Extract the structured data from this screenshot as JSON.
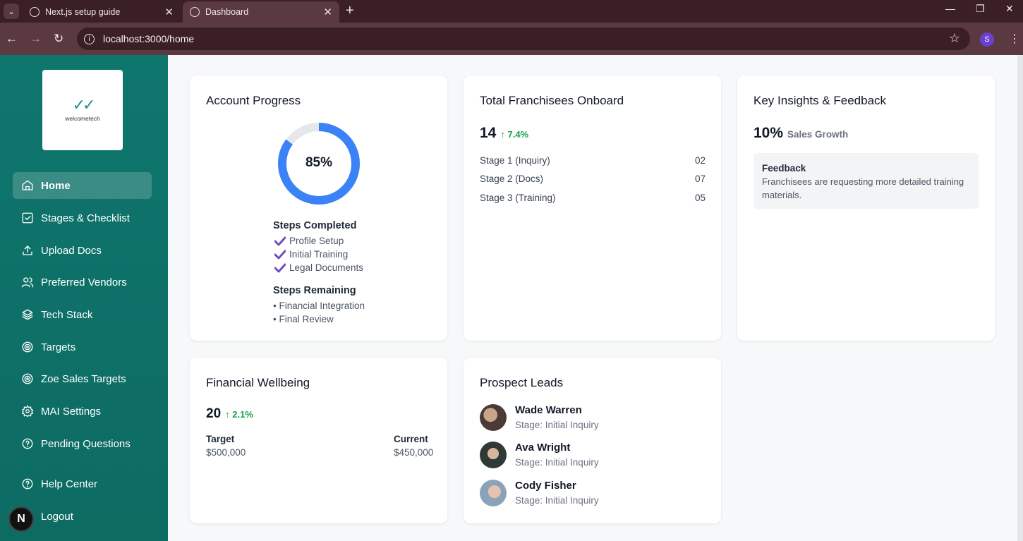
{
  "browser": {
    "tabs": [
      {
        "title": "Next.js setup guide"
      },
      {
        "title": "Dashboard"
      }
    ],
    "url": "localhost:3000/home",
    "profile_initial": "S"
  },
  "sidebar": {
    "logo_text": "welcometech",
    "items": [
      {
        "label": "Home",
        "icon": "home-icon"
      },
      {
        "label": "Stages & Checklist",
        "icon": "checklist-icon"
      },
      {
        "label": "Upload Docs",
        "icon": "upload-icon"
      },
      {
        "label": "Preferred Vendors",
        "icon": "users-icon"
      },
      {
        "label": "Tech Stack",
        "icon": "layers-icon"
      },
      {
        "label": "Targets",
        "icon": "target-icon"
      },
      {
        "label": "Zoe Sales Targets",
        "icon": "target-icon"
      },
      {
        "label": "MAI Settings",
        "icon": "gear-icon"
      },
      {
        "label": "Pending Questions",
        "icon": "help-circle-icon"
      },
      {
        "label": "Help Center",
        "icon": "help-circle-icon"
      },
      {
        "label": "Logout",
        "icon": "logout-icon"
      }
    ],
    "badge": "N"
  },
  "account_progress": {
    "title": "Account Progress",
    "percent_label": "85%",
    "percent": 85,
    "completed_title": "Steps Completed",
    "completed": [
      "Profile Setup",
      "Initial Training",
      "Legal Documents"
    ],
    "remaining_title": "Steps Remaining",
    "remaining": [
      "• Financial Integration",
      "• Final Review"
    ]
  },
  "franchisees": {
    "title": "Total Franchisees Onboard",
    "total": "14",
    "delta": "↑ 7.4%",
    "stages": [
      {
        "label": "Stage 1 (Inquiry)",
        "value": "02"
      },
      {
        "label": "Stage 2 (Docs)",
        "value": "07"
      },
      {
        "label": "Stage 3 (Training)",
        "value": "05"
      }
    ]
  },
  "insights": {
    "title": "Key Insights & Feedback",
    "value": "10%",
    "value_label": "Sales Growth",
    "feedback_title": "Feedback",
    "feedback_text": "Franchisees are requesting more detailed training materials."
  },
  "financial": {
    "title": "Financial Wellbeing",
    "value": "20",
    "delta": "↑ 2.1%",
    "target_label": "Target",
    "target_value": "$500,000",
    "current_label": "Current",
    "current_value": "$450,000"
  },
  "leads": {
    "title": "Prospect Leads",
    "items": [
      {
        "name": "Wade Warren",
        "stage": "Stage: Initial Inquiry"
      },
      {
        "name": "Ava Wright",
        "stage": "Stage: Initial Inquiry"
      },
      {
        "name": "Cody Fisher",
        "stage": "Stage: Initial Inquiry"
      }
    ]
  },
  "colors": {
    "sidebar": "#0f766e",
    "accent_ring": "#3b82f6",
    "positive": "#16a34a",
    "check": "#6d4fc2"
  }
}
